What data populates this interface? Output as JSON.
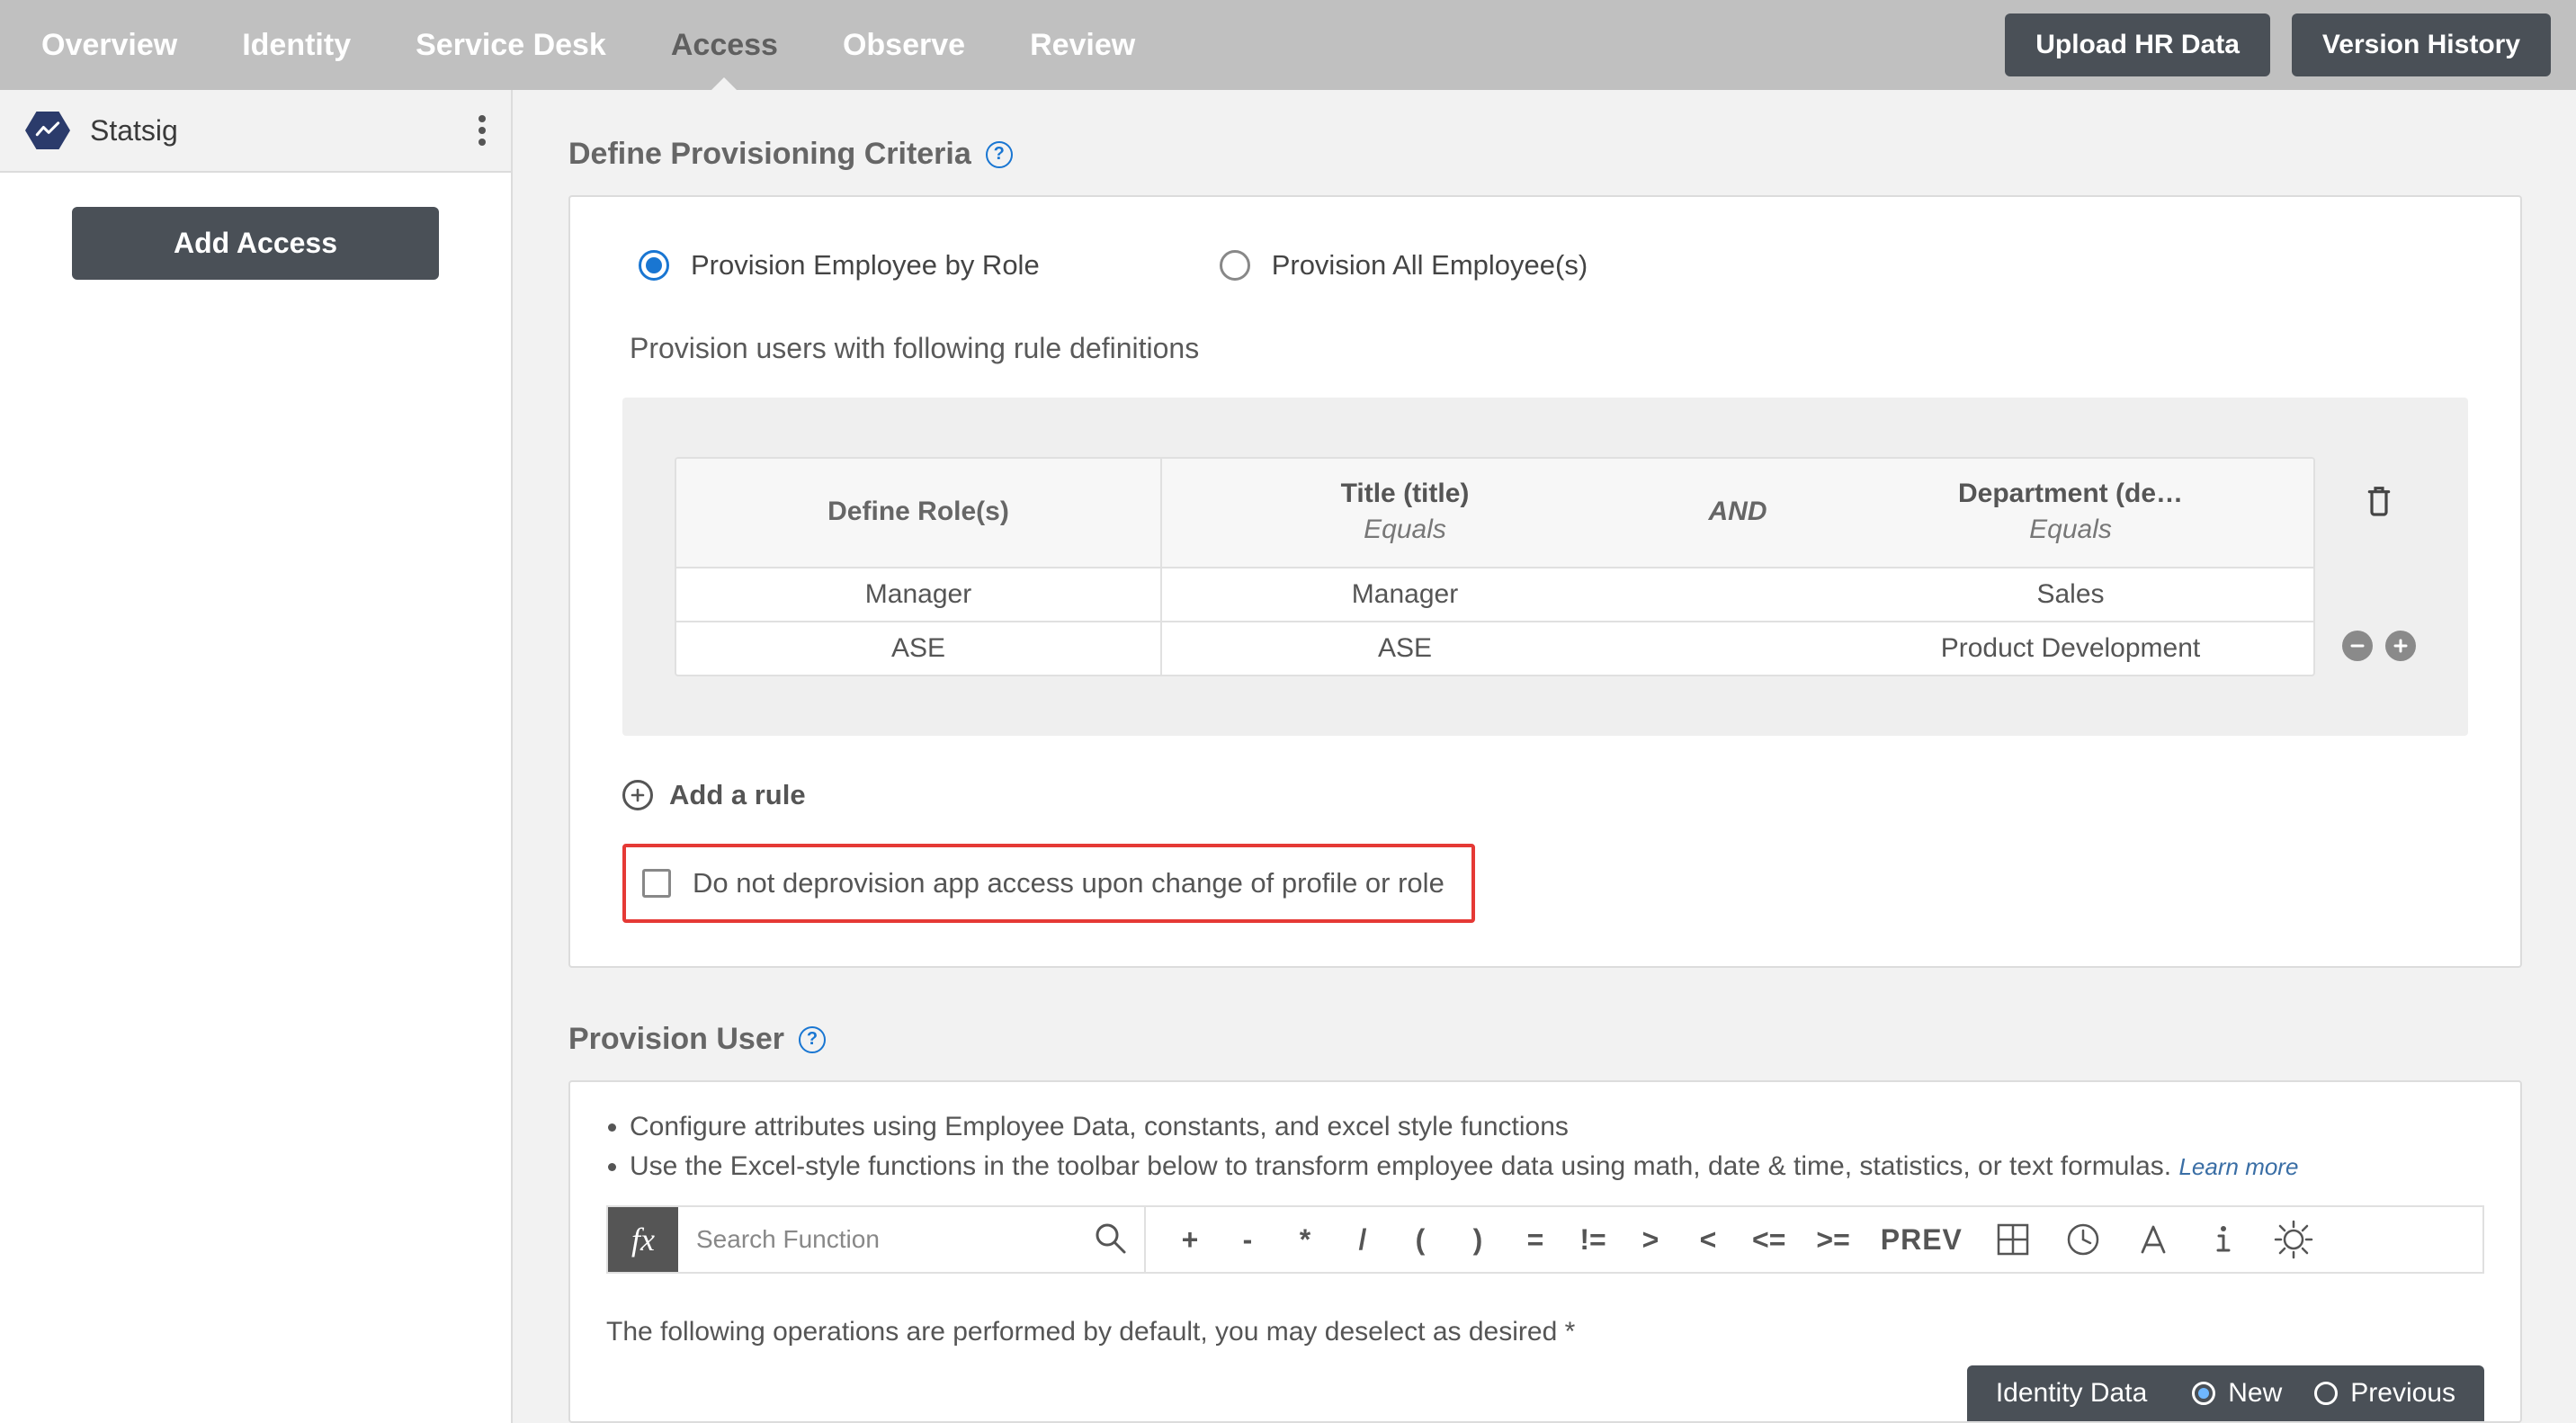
{
  "nav": {
    "tabs": [
      "Overview",
      "Identity",
      "Service Desk",
      "Access",
      "Observe",
      "Review"
    ],
    "active_index": 3,
    "upload_btn": "Upload HR Data",
    "version_btn": "Version History"
  },
  "sidebar": {
    "app_name": "Statsig",
    "add_access_btn": "Add Access"
  },
  "criteria": {
    "title": "Define Provisioning Criteria",
    "radio_by_role": "Provision Employee by Role",
    "radio_all": "Provision All Employee(s)",
    "sub_caption": "Provision users with following rule definitions",
    "table": {
      "col_define": "Define Role(s)",
      "col_title_l1": "Title (title)",
      "col_title_l2": "Equals",
      "col_and": "AND",
      "col_dept_l1": "Department (de…",
      "col_dept_l2": "Equals",
      "rows": [
        {
          "define": "Manager",
          "title": "Manager",
          "dept": "Sales"
        },
        {
          "define": "ASE",
          "title": "ASE",
          "dept": "Product Development"
        }
      ]
    },
    "add_rule": "Add a rule",
    "deprovision_check_label": "Do not deprovision app access upon change of profile or role"
  },
  "provision_user": {
    "title": "Provision User",
    "bullet1": "Configure attributes using Employee Data, constants, and excel style functions",
    "bullet2": "Use the Excel-style functions in the toolbar below to transform employee data using math, date & time, statistics, or text formulas.",
    "learn_more": "Learn more",
    "fx_label": "fx",
    "search_placeholder": "Search Function",
    "ops": [
      "+",
      "-",
      "*",
      "/",
      "(",
      ")",
      "=",
      "!=",
      ">",
      "<",
      "<=",
      ">="
    ],
    "prev": "PREV",
    "default_ops_text": "The following operations are performed by default, you may deselect as desired *"
  },
  "footer": {
    "identity_label": "Identity Data",
    "opt_new": "New",
    "opt_prev": "Previous"
  }
}
